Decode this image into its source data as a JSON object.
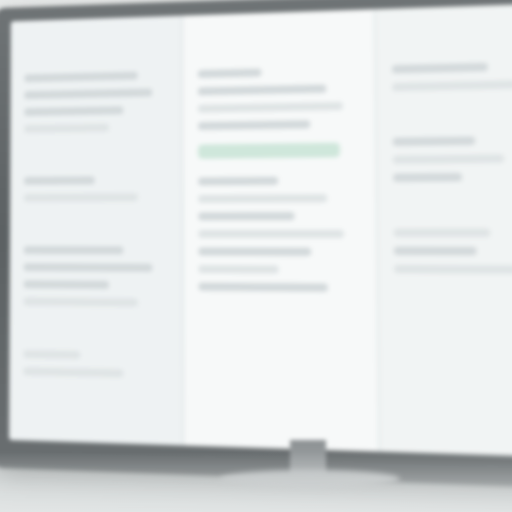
{
  "app": {
    "title": ""
  },
  "colors": {
    "bezel": "#5c6163",
    "screen_bg": "#f4f6f6",
    "accent_green": "#cfe7db",
    "placeholder_text": "#d3d9db"
  },
  "panels": {
    "left": {
      "heading": ""
    },
    "middle": {
      "heading": ""
    },
    "right": {
      "heading": ""
    }
  }
}
